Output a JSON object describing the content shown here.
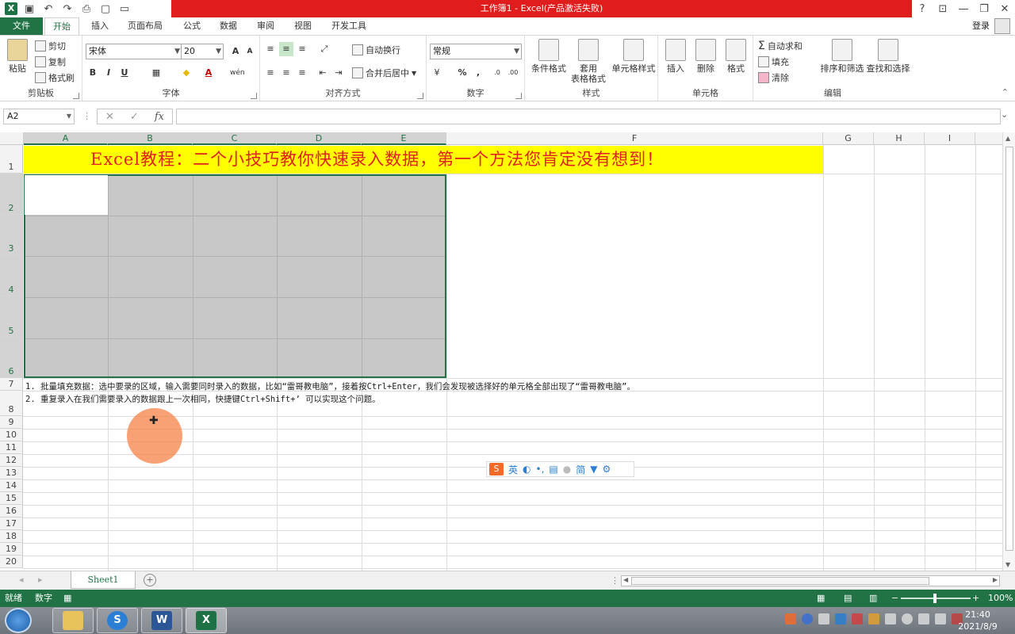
{
  "window": {
    "title": "工作簿1 - Excel(产品激活失败)",
    "controls": [
      "?",
      "⊡",
      "—",
      "❐",
      "✕"
    ]
  },
  "tabs": {
    "file": "文件",
    "items": [
      "开始",
      "插入",
      "页面布局",
      "公式",
      "数据",
      "审阅",
      "视图",
      "开发工具"
    ],
    "active": "开始",
    "login": "登录"
  },
  "ribbon": {
    "clipboard": {
      "label": "剪贴板",
      "paste": "粘贴",
      "cut": "剪切",
      "copy": "复制",
      "format_painter": "格式刷"
    },
    "font": {
      "label": "字体",
      "name": "宋体",
      "size": "20",
      "bold": "B",
      "italic": "I",
      "underline": "U"
    },
    "alignment": {
      "label": "对齐方式",
      "wrap": "自动换行",
      "merge": "合并后居中"
    },
    "number": {
      "label": "数字",
      "format": "常规"
    },
    "styles": {
      "label": "样式",
      "conditional": "条件格式",
      "table_l1": "套用",
      "table_l2": "表格格式",
      "cell_styles": "单元格样式"
    },
    "cells": {
      "label": "单元格",
      "insert": "插入",
      "delete": "删除",
      "format": "格式"
    },
    "editing": {
      "label": "编辑",
      "autosum": "自动求和",
      "fill": "填充",
      "clear": "清除",
      "sort": "排序和筛选",
      "find": "查找和选择"
    }
  },
  "formula_bar": {
    "name_box": "A2",
    "fx": "fx",
    "value": ""
  },
  "columns": [
    "A",
    "B",
    "C",
    "D",
    "E",
    "F",
    "G",
    "H",
    "I"
  ],
  "rows": [
    "1",
    "2",
    "3",
    "4",
    "5",
    "6",
    "7",
    "8",
    "9",
    "10",
    "11",
    "12",
    "13",
    "14",
    "15",
    "16",
    "17",
    "18",
    "19",
    "20"
  ],
  "cells": {
    "F1_title": "Excel教程：二个小技巧教你快速录入数据，第一个方法您肯定没有想到！",
    "A7_note": "1.    批量填充数据：选中要录的区域，输入需要同时录入的数据，比如“雷哥教电脑”，接着按Ctrl+Enter，我们会发现被选择好的单元格全部出现了“雷哥教电脑”。",
    "A8_note": "2.    重复录入在我们需要录入的数据跟上一次相同，快捷键Ctrl+Shift+’ 可以实现这个问题。"
  },
  "ime": {
    "items": [
      "英",
      "简"
    ]
  },
  "sheets": {
    "tabs": [
      "Sheet1"
    ],
    "add": "+"
  },
  "status": {
    "mode": "就绪",
    "num": "数字",
    "zoom": "100%"
  },
  "taskbar": {
    "time": "21:40",
    "date": "2021/8/9"
  },
  "colors": {
    "excel_green": "#217346",
    "title_bg": "#e01c1c",
    "highlight_yellow": "#ffff00",
    "title_text_red": "#e02020",
    "selection_gray": "#c8c8c8"
  }
}
